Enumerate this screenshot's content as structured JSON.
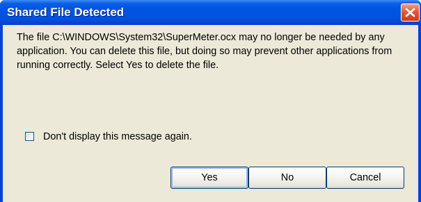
{
  "dialog": {
    "title": "Shared File Detected",
    "message": "The file C:\\WINDOWS\\System32\\SuperMeter.ocx may no longer be needed by any application. You can delete this file, but doing so may prevent other applications from running correctly.  Select Yes to delete the file.",
    "checkbox": {
      "label": "Don't display this message again.",
      "checked": false
    },
    "buttons": {
      "yes": "Yes",
      "no": "No",
      "cancel": "Cancel"
    },
    "close_icon": "close-icon"
  },
  "colors": {
    "titlebar": "#0054e3",
    "close_button": "#e2583d",
    "client_background": "#ece9d8",
    "button_border": "#003c74"
  }
}
